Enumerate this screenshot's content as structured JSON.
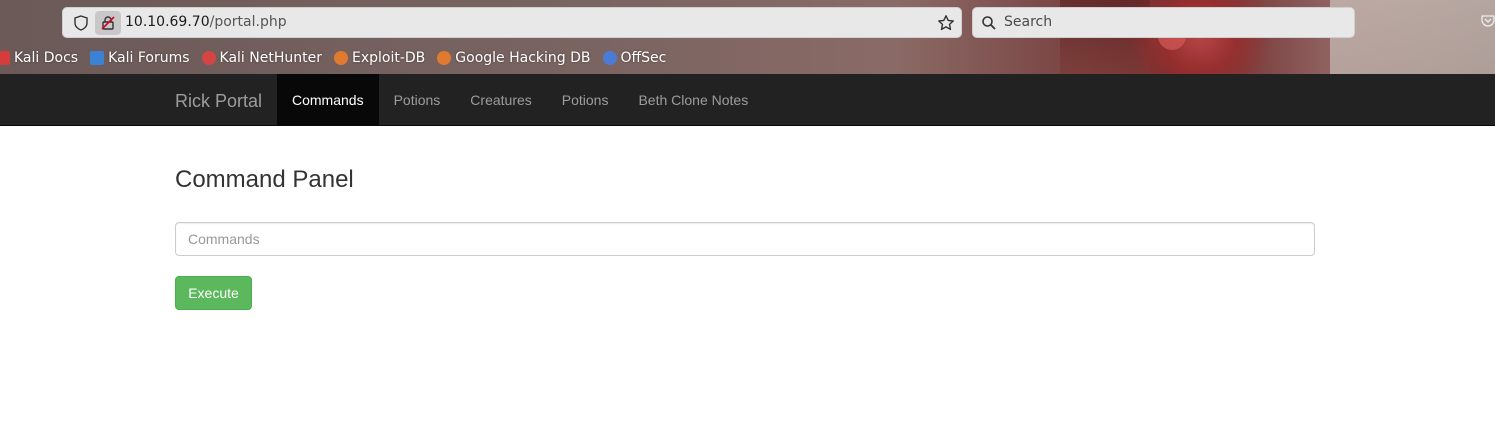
{
  "browser": {
    "url_host": "10.10.69.70",
    "url_path": "/portal.php",
    "search_placeholder": "Search",
    "bookmarks": [
      {
        "label": "Kali Docs",
        "icon": "kali-docs-icon",
        "color": "#d63c3c"
      },
      {
        "label": "Kali Forums",
        "icon": "kali-forums-icon",
        "color": "#3b82d6"
      },
      {
        "label": "Kali NetHunter",
        "icon": "kali-nethunter-icon",
        "color": "#d64545"
      },
      {
        "label": "Exploit-DB",
        "icon": "exploit-db-icon",
        "color": "#e07a2e"
      },
      {
        "label": "Google Hacking DB",
        "icon": "ghdb-icon",
        "color": "#e07a2e"
      },
      {
        "label": "OffSec",
        "icon": "offsec-icon",
        "color": "#4a7bd6"
      }
    ]
  },
  "navbar": {
    "brand": "Rick Portal",
    "items": [
      {
        "label": "Commands",
        "active": true
      },
      {
        "label": "Potions",
        "active": false
      },
      {
        "label": "Creatures",
        "active": false
      },
      {
        "label": "Potions",
        "active": false
      },
      {
        "label": "Beth Clone Notes",
        "active": false
      }
    ]
  },
  "main": {
    "title": "Command Panel",
    "input_placeholder": "Commands",
    "input_value": "",
    "button_label": "Execute"
  },
  "colors": {
    "navbar_bg": "#222222",
    "active_tab_bg": "#080808",
    "button_success": "#5cb85c"
  }
}
